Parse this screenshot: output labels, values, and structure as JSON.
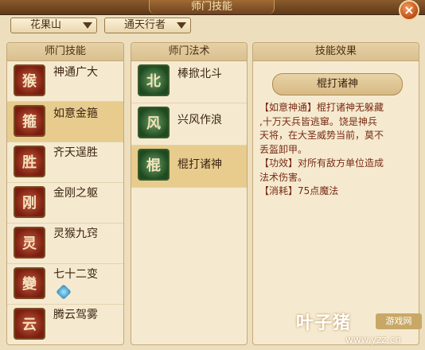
{
  "window": {
    "title": "师门技能",
    "close_label": "×"
  },
  "filters": {
    "sect": "花果山",
    "role": "通天行者"
  },
  "panels": {
    "skills_header": "师门技能",
    "spells_header": "师门法术",
    "effect_header": "技能效果"
  },
  "skills": [
    {
      "name": "神通广大",
      "icon": "monkey-king-icon",
      "selected": false
    },
    {
      "name": "如意金箍",
      "icon": "golden-staff-icon",
      "selected": true
    },
    {
      "name": "齐天逞胜",
      "icon": "cloud-weapon-icon",
      "selected": false
    },
    {
      "name": "金刚之躯",
      "icon": "armor-body-icon",
      "selected": false
    },
    {
      "name": "灵猴九窍",
      "icon": "monkey-face-icon",
      "selected": false
    },
    {
      "name": "七十二变",
      "icon": "transform-icon",
      "selected": false
    },
    {
      "name": "腾云驾雾",
      "icon": "cloud-icon",
      "selected": false
    }
  ],
  "spells": [
    {
      "name": "棒掀北斗",
      "icon": "staff-sweep-icon",
      "selected": false
    },
    {
      "name": "兴风作浪",
      "icon": "wind-wave-icon",
      "selected": false
    },
    {
      "name": "棍打诸神",
      "icon": "staff-strike-icon",
      "selected": true
    }
  ],
  "effect": {
    "spell_name": "棍打诸神",
    "line1": "【如意神通】棍打诸神无躲藏",
    "line2": ",十万天兵皆逃窜。饶是神兵",
    "line3": "天将，在大圣威势当前，莫不",
    "line4": "丢盔卸甲。",
    "line5": "【功效】对所有敌方单位造成",
    "line6": "法术伤害。",
    "line7": "【消耗】75点魔法"
  },
  "watermark": {
    "logo": "叶子猪",
    "site": "游戏网",
    "url": "www.yzz.cn"
  }
}
